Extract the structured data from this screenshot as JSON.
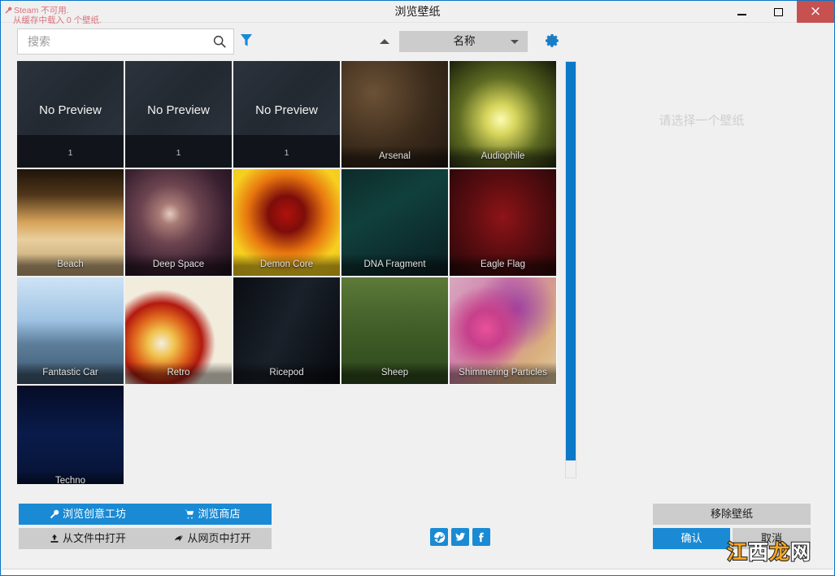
{
  "window": {
    "title": "浏览壁纸",
    "controls": {
      "minimize": "minimize-button",
      "maximize": "maximize-button",
      "close": "×"
    },
    "accent_color": "#1a8ad4",
    "close_color": "#c75050"
  },
  "status": {
    "steam_unavailable": "Steam 不可用.",
    "cache_loaded": "从缓存中载入 0 个壁纸.",
    "color": "#d9737d"
  },
  "toolbar": {
    "search_placeholder": "搜索",
    "search_value": "",
    "search_icon": "search-icon",
    "filter_icon": "filter-funnel-icon",
    "sort_direction_icon": "sort-ascending-icon",
    "sort_selected": "名称",
    "settings_icon": "gear-icon"
  },
  "preview": {
    "empty_text": "请选择一个壁纸"
  },
  "scrollbar": {
    "thumb_color": "#0c78c8"
  },
  "grid": {
    "tiles": [
      {
        "label": "No Preview",
        "count": "1",
        "art": "noprev",
        "selected": false
      },
      {
        "label": "No Preview",
        "count": "1",
        "art": "noprev",
        "selected": false
      },
      {
        "label": "No Preview",
        "count": "1",
        "art": "noprev",
        "selected": false
      },
      {
        "label": "Arsenal",
        "art": "arsenal",
        "selected": false
      },
      {
        "label": "Audiophile",
        "art": "audiophile",
        "selected": false
      },
      {
        "label": "Beach",
        "art": "beach",
        "selected": false
      },
      {
        "label": "Deep Space",
        "art": "deepspace",
        "selected": false
      },
      {
        "label": "Demon Core",
        "art": "demoncore",
        "selected": false
      },
      {
        "label": "DNA Fragment",
        "art": "dna",
        "selected": false
      },
      {
        "label": "Eagle Flag",
        "art": "eagleflag",
        "selected": false
      },
      {
        "label": "Fantastic Car",
        "art": "car",
        "selected": false
      },
      {
        "label": "Retro",
        "art": "retro",
        "selected": false
      },
      {
        "label": "Ricepod",
        "art": "ricepod",
        "selected": false
      },
      {
        "label": "Sheep",
        "art": "sheep",
        "selected": false
      },
      {
        "label": "Shimmering Particles",
        "art": "particles",
        "selected": true
      },
      {
        "label": "Techno",
        "art": "techno",
        "selected": false
      }
    ]
  },
  "actions": {
    "browse_workshop": "浏览创意工坊",
    "browse_store": "浏览商店",
    "open_from_file": "从文件中打开",
    "open_from_web": "从网页中打开",
    "remove_wallpaper": "移除壁纸",
    "confirm": "确认",
    "cancel": "取消"
  },
  "social": {
    "steam": "steam-icon",
    "twitter": "twitter-icon",
    "facebook": "facebook-icon"
  },
  "watermark": {
    "part1": "江",
    "part2": "西",
    "part3": "龙",
    "part4": "网"
  }
}
